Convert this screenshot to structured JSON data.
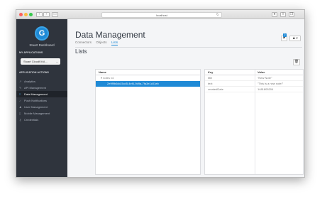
{
  "browser": {
    "url": "localhost",
    "colors": {
      "close": "#fc605c",
      "minimize": "#fdbc40",
      "maximize": "#34c84a"
    }
  },
  "sidebar": {
    "logo_glyph": "G",
    "brand": "Stuart Dashboard",
    "my_apps_label": "MY APPLICATIONS",
    "selected_app": "Stuart CloudKit A...",
    "actions_label": "APPLICATION ACTIONS",
    "items": [
      {
        "label": "Analytics",
        "icon": "chart-icon"
      },
      {
        "label": "API Management",
        "icon": "wrench-icon"
      },
      {
        "label": "Data Management",
        "icon": "database-icon",
        "active": true
      },
      {
        "label": "Push Notifications",
        "icon": "bell-icon"
      },
      {
        "label": "User Management",
        "icon": "users-icon"
      },
      {
        "label": "Mobile Management",
        "icon": "mobile-icon"
      },
      {
        "label": "Credentials",
        "icon": "key-icon"
      }
    ]
  },
  "main": {
    "title": "Data Management",
    "tabs": [
      {
        "label": "Connectors"
      },
      {
        "label": "Objects"
      },
      {
        "label": "Lists"
      }
    ],
    "notification_count": "2",
    "section": "Lists",
    "tree": {
      "header": "Name",
      "rows": [
        {
          "label": "▾  notes v4"
        },
        {
          "label": "2e9f9b6dd-5cd5-4ef4-9d9a-7fa3e1c01eb"
        }
      ]
    },
    "detail": {
      "key_header": "Key",
      "value_header": "Value",
      "rows": [
        {
          "key": "title",
          "value": "\"New Note\""
        },
        {
          "key": "text",
          "value": "\"This is a new note!\""
        },
        {
          "key": "createdDate",
          "value": "1481805204"
        }
      ]
    }
  },
  "colors": {
    "accent": "#1f8ad6",
    "sidebar_bg": "#2f343d",
    "sidebar_active_bg": "#1f232a"
  }
}
